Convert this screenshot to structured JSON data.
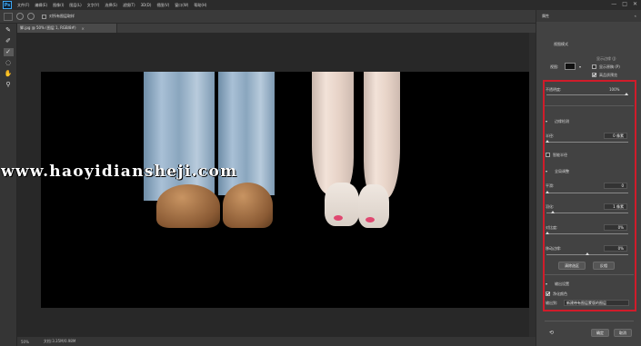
{
  "app": {
    "logo": "Ps",
    "menu": [
      "文件(F)",
      "编辑(E)",
      "图像(I)",
      "图层(L)",
      "文字(Y)",
      "选择(S)",
      "滤镜(T)",
      "3D(D)",
      "视图(V)",
      "窗口(W)",
      "帮助(H)"
    ],
    "window_buttons": [
      "—",
      "□",
      "✕"
    ]
  },
  "options_bar": {
    "checkbox_label": "对所有图层取样"
  },
  "tools": [
    "refine-radius-icon",
    "brush-icon",
    "brush-erase-icon",
    "lasso-icon",
    "hand-icon",
    "zoom-icon"
  ],
  "document": {
    "tab_label": "脚.jpg @ 50% (图层 1, RGB/8#)",
    "tab_close": "×"
  },
  "status": {
    "zoom": "50%",
    "doc_info": "文档:3.35M/0.98M"
  },
  "properties": {
    "title": "属性",
    "close": "«",
    "view_mode_label": "视图模式",
    "view_label": "视图:",
    "show_edges_label": "显示边缘 (J)",
    "show_original_label": "显示原稿 (P)",
    "high_quality_label": "高品质预览",
    "opacity_label": "不透明度:",
    "opacity_value": "100%",
    "edge_detect_section": "边缘检测",
    "radius_label": "半径:",
    "radius_value": "0 像素",
    "smart_radius_label": "智能半径",
    "global_refine_section": "全局调整",
    "smooth_label": "平滑:",
    "smooth_value": "0",
    "feather_label": "羽化:",
    "feather_value": "1 像素",
    "contrast_label": "对比度:",
    "contrast_value": "0%",
    "shift_edge_label": "移动边缘:",
    "shift_edge_value": "0%",
    "clear_selection_button": "清除选区",
    "invert_button": "反相",
    "output_section": "输出设置",
    "decontaminate_label": "净化颜色",
    "output_to_label": "输出到:",
    "output_to_value": "新建带有图层蒙版的图层",
    "ok_button": "确定",
    "cancel_button": "取消"
  },
  "watermark": "www.haoyidiansheji.com",
  "colors": {
    "highlight": "#d01c2a",
    "panel_bg": "#424242",
    "canvas_bg": "#000000"
  }
}
